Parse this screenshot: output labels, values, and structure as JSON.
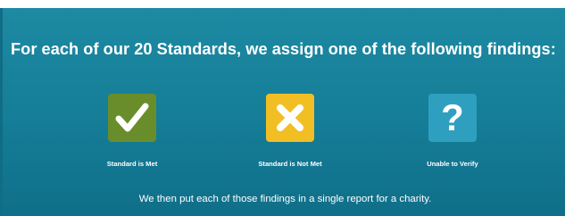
{
  "headline": "For each of our 20 Standards, we assign one of the following findings:",
  "findings": [
    {
      "label": "Standard is Met",
      "icon": "checkmark-icon",
      "color": "#6a8d2c"
    },
    {
      "label": "Standard is Not Met",
      "icon": "x-mark-icon",
      "color": "#f1bf24"
    },
    {
      "label": "Unable to Verify",
      "icon": "question-mark-icon",
      "color": "#2f9fc0",
      "glyph": "?"
    }
  ],
  "footnote": "We then put each of those findings in a single report for a charity.",
  "colors": {
    "panel_background": "#157d97",
    "text": "#ffffff"
  }
}
